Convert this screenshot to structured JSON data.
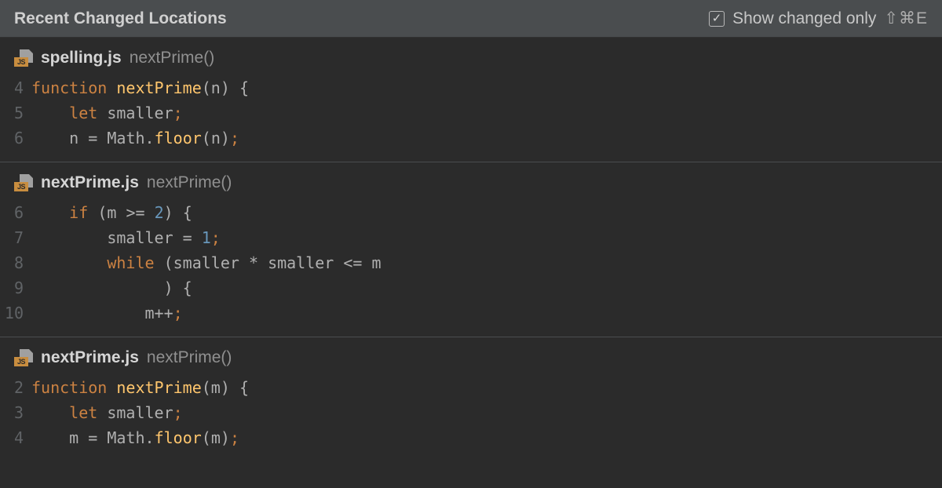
{
  "header": {
    "title": "Recent Changed Locations",
    "show_changed_label": "Show changed only",
    "shortcut": "⇧⌘E",
    "checkmark": "✓",
    "js_icon_label": "JS"
  },
  "locations": [
    {
      "file": "spelling.js",
      "function": "nextPrime()",
      "lines": [
        {
          "n": "4",
          "tokens": [
            [
              "kw",
              "function"
            ],
            [
              "sp",
              " "
            ],
            [
              "fn",
              "nextPrime"
            ],
            [
              "op",
              "("
            ],
            [
              "var",
              "n"
            ],
            [
              "op",
              ")"
            ],
            [
              "sp",
              " "
            ],
            [
              "op",
              "{"
            ]
          ]
        },
        {
          "n": "5",
          "tokens": [
            [
              "sp",
              "    "
            ],
            [
              "kw",
              "let"
            ],
            [
              "sp",
              " "
            ],
            [
              "var",
              "smaller"
            ],
            [
              "punct",
              ";"
            ]
          ]
        },
        {
          "n": "6",
          "tokens": [
            [
              "sp",
              "    "
            ],
            [
              "var",
              "n "
            ],
            [
              "op",
              "="
            ],
            [
              "sp",
              " "
            ],
            [
              "var",
              "Math"
            ],
            [
              "op",
              "."
            ],
            [
              "fn",
              "floor"
            ],
            [
              "op",
              "("
            ],
            [
              "var",
              "n"
            ],
            [
              "op",
              ")"
            ],
            [
              "punct",
              ";"
            ]
          ]
        }
      ]
    },
    {
      "file": "nextPrime.js",
      "function": "nextPrime()",
      "lines": [
        {
          "n": " 6",
          "tokens": [
            [
              "sp",
              "    "
            ],
            [
              "kw",
              "if"
            ],
            [
              "sp",
              " "
            ],
            [
              "op",
              "("
            ],
            [
              "var",
              "m "
            ],
            [
              "op",
              ">="
            ],
            [
              "sp",
              " "
            ],
            [
              "num",
              "2"
            ],
            [
              "op",
              ")"
            ],
            [
              "sp",
              " "
            ],
            [
              "op",
              "{"
            ]
          ]
        },
        {
          "n": " 7",
          "tokens": [
            [
              "sp",
              "        "
            ],
            [
              "var",
              "smaller "
            ],
            [
              "op",
              "="
            ],
            [
              "sp",
              " "
            ],
            [
              "num",
              "1"
            ],
            [
              "punct",
              ";"
            ]
          ]
        },
        {
          "n": " 8",
          "tokens": [
            [
              "sp",
              "        "
            ],
            [
              "kw",
              "while"
            ],
            [
              "sp",
              " "
            ],
            [
              "op",
              "("
            ],
            [
              "var",
              "smaller "
            ],
            [
              "op",
              "*"
            ],
            [
              "sp",
              " "
            ],
            [
              "var",
              "smaller "
            ],
            [
              "op",
              "<="
            ],
            [
              "sp",
              " "
            ],
            [
              "var",
              "m"
            ]
          ]
        },
        {
          "n": " 9",
          "tokens": [
            [
              "sp",
              "              "
            ],
            [
              "op",
              ")"
            ],
            [
              "sp",
              " "
            ],
            [
              "op",
              "{"
            ]
          ]
        },
        {
          "n": "10",
          "tokens": [
            [
              "sp",
              "            "
            ],
            [
              "var",
              "m"
            ],
            [
              "op",
              "++"
            ],
            [
              "punct",
              ";"
            ]
          ]
        }
      ]
    },
    {
      "file": "nextPrime.js",
      "function": "nextPrime()",
      "lines": [
        {
          "n": "2",
          "tokens": [
            [
              "kw",
              "function"
            ],
            [
              "sp",
              " "
            ],
            [
              "fn",
              "nextPrime"
            ],
            [
              "op",
              "("
            ],
            [
              "var",
              "m"
            ],
            [
              "op",
              ")"
            ],
            [
              "sp",
              " "
            ],
            [
              "op",
              "{"
            ]
          ]
        },
        {
          "n": "3",
          "tokens": [
            [
              "sp",
              "    "
            ],
            [
              "kw",
              "let"
            ],
            [
              "sp",
              " "
            ],
            [
              "var",
              "smaller"
            ],
            [
              "punct",
              ";"
            ]
          ]
        },
        {
          "n": "4",
          "tokens": [
            [
              "sp",
              "    "
            ],
            [
              "var",
              "m "
            ],
            [
              "op",
              "="
            ],
            [
              "sp",
              " "
            ],
            [
              "var",
              "Math"
            ],
            [
              "op",
              "."
            ],
            [
              "fn",
              "floor"
            ],
            [
              "op",
              "("
            ],
            [
              "var",
              "m"
            ],
            [
              "op",
              ")"
            ],
            [
              "punct",
              ";"
            ]
          ]
        }
      ]
    }
  ]
}
